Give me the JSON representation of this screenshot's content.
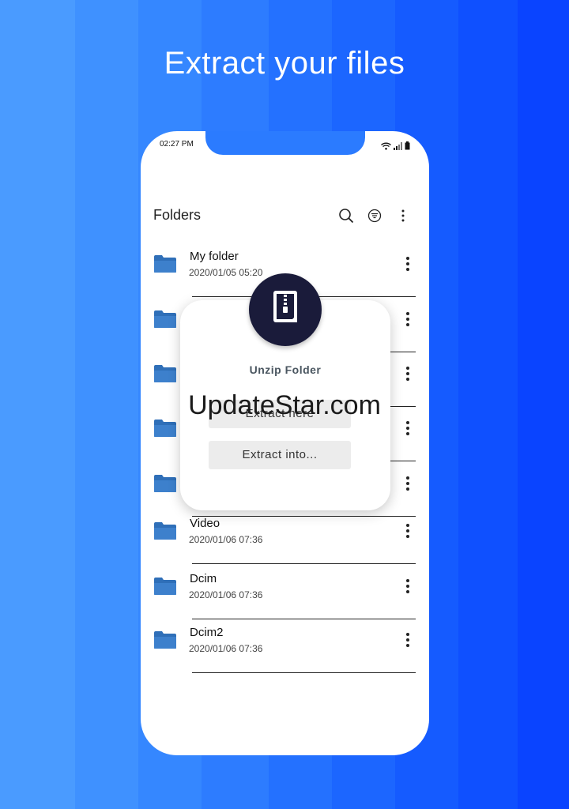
{
  "headline": "Extract your files",
  "status": {
    "time": "02:27 PM"
  },
  "appbar": {
    "title": "Folders",
    "actions": [
      "search-icon",
      "filter-icon",
      "more-vertical-icon"
    ]
  },
  "folders": [
    {
      "name": "My folder",
      "date": "2020/01/05 05:20"
    },
    {
      "name": "",
      "date": ""
    },
    {
      "name": "",
      "date": ""
    },
    {
      "name": "",
      "date": ""
    },
    {
      "name": "",
      "date": ""
    },
    {
      "name": "Video",
      "date": "2020/01/06 07:36"
    },
    {
      "name": "Dcim",
      "date": "2020/01/06 07:36"
    },
    {
      "name": "Dcim2",
      "date": "2020/01/06 07:36"
    }
  ],
  "dialog": {
    "title": "Unzip Folder",
    "extract_here": "Extract here",
    "extract_into": "Extract into...",
    "icon": "zip-file-icon"
  },
  "watermark": "UpdateStar.com",
  "colors": {
    "accent": "#2b7bff",
    "badge": "#1a1b3a",
    "folder": "#2f6fb8"
  }
}
